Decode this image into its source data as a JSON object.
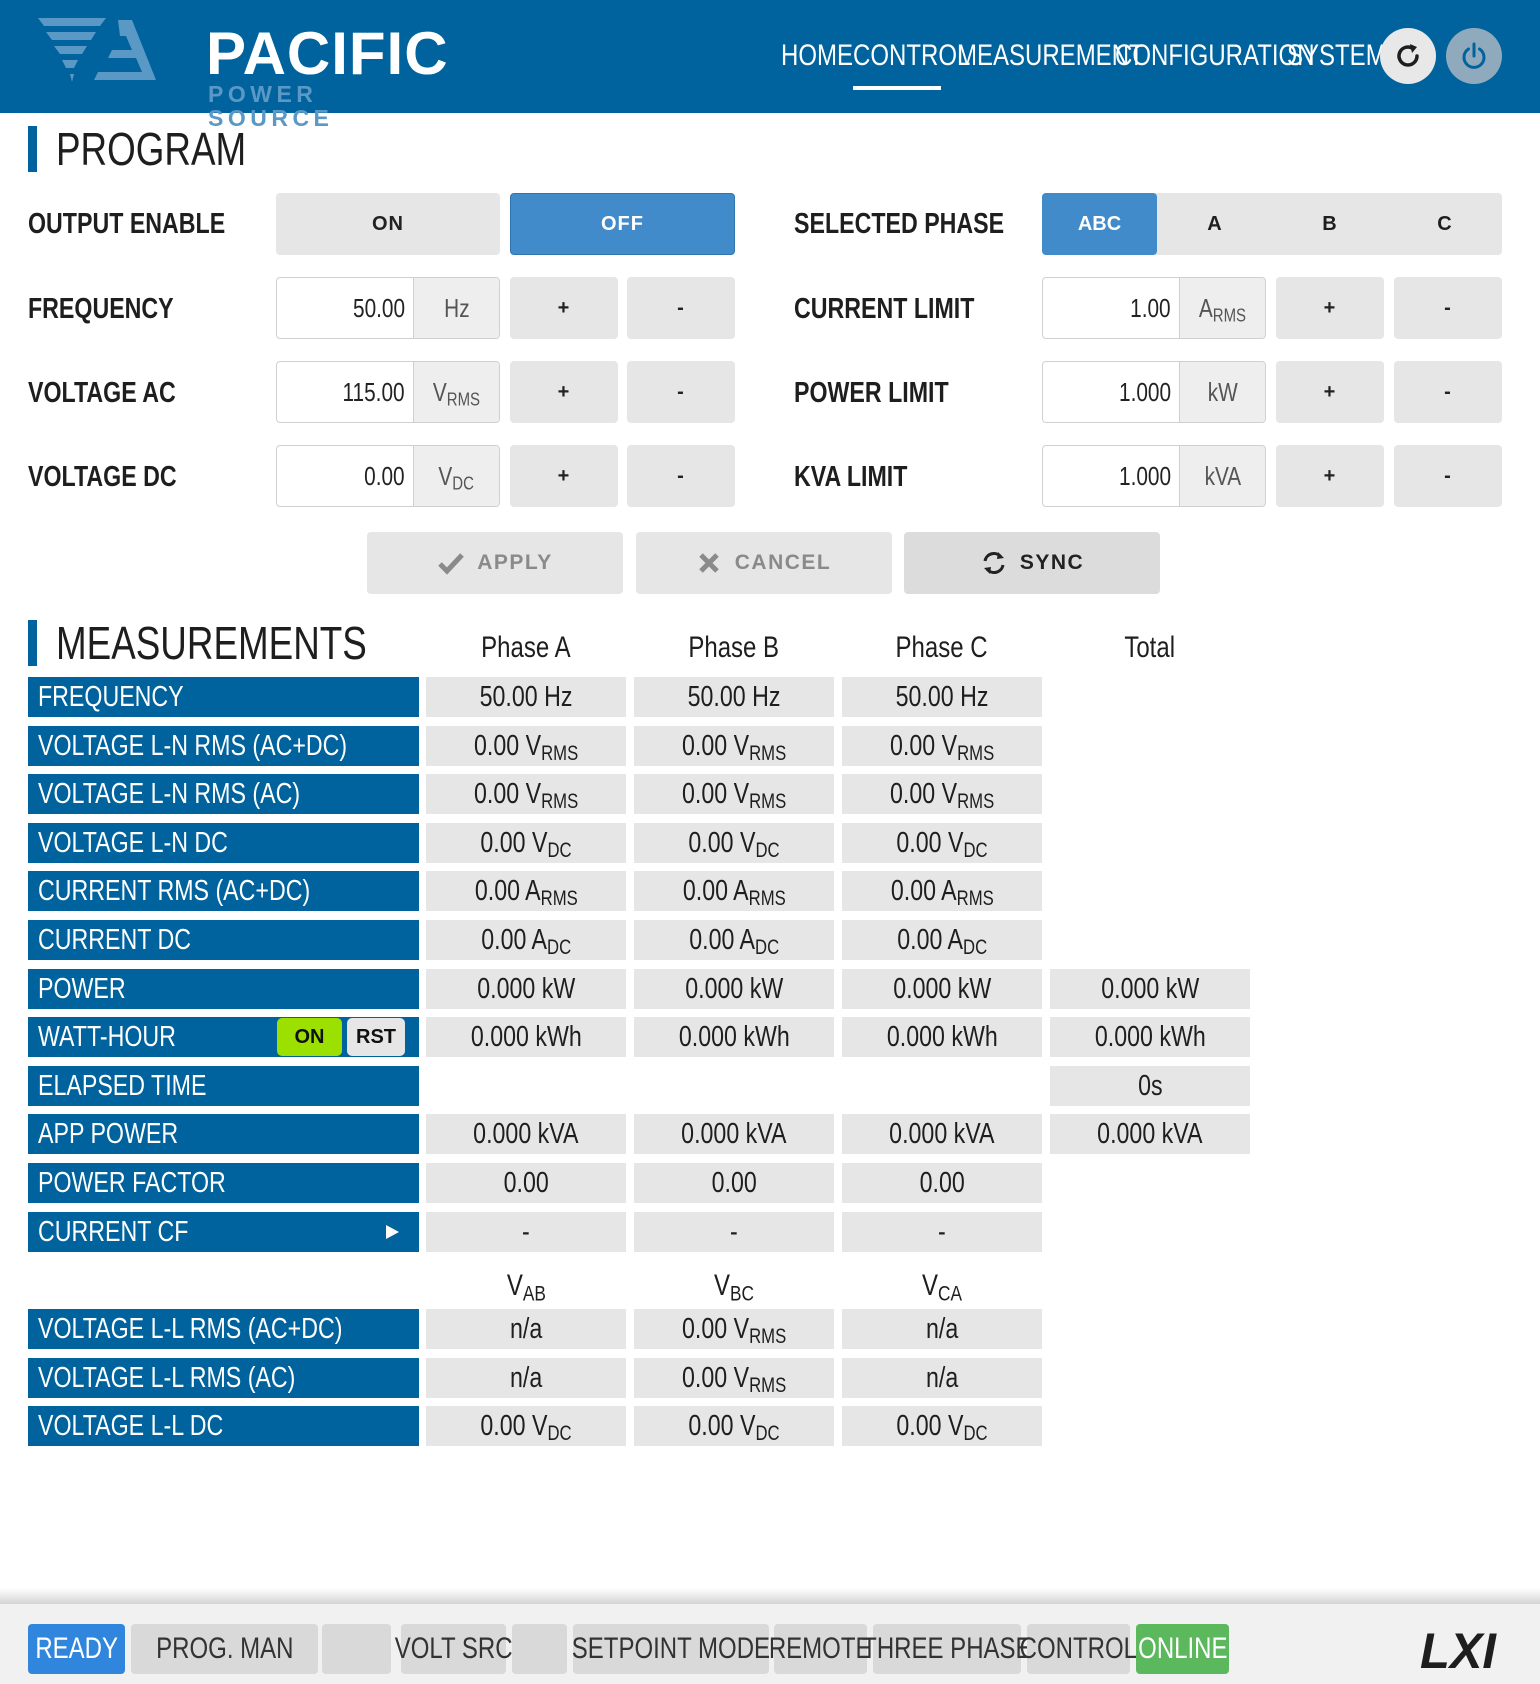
{
  "brand": {
    "name": "PACIFIC",
    "subtitle": "POWER SOURCE"
  },
  "nav": [
    {
      "label": "HOME",
      "active": false
    },
    {
      "label": "CONTROL",
      "active": true
    },
    {
      "label": "MEASUREMENT",
      "active": false
    },
    {
      "label": "CONFIGURATION",
      "active": false
    },
    {
      "label": "SYSTEM",
      "active": false
    }
  ],
  "header_icons": [
    "refresh-icon",
    "power-icon"
  ],
  "program": {
    "title": "PROGRAM",
    "output_enable": {
      "label": "OUTPUT ENABLE",
      "on": "ON",
      "off": "OFF",
      "selected": "OFF"
    },
    "selected_phase": {
      "label": "SELECTED PHASE",
      "options": [
        "ABC",
        "A",
        "B",
        "C"
      ],
      "selected": "ABC"
    },
    "frequency": {
      "label": "FREQUENCY",
      "value": "50.00",
      "unit": "Hz"
    },
    "voltage_ac": {
      "label": "VOLTAGE AC",
      "value": "115.00",
      "unit": "V",
      "unit_sub": "RMS"
    },
    "voltage_dc": {
      "label": "VOLTAGE DC",
      "value": "0.00",
      "unit": "V",
      "unit_sub": "DC"
    },
    "current_limit": {
      "label": "CURRENT LIMIT",
      "value": "1.00",
      "unit": "A",
      "unit_sub": "RMS"
    },
    "power_limit": {
      "label": "POWER LIMIT",
      "value": "1.000",
      "unit": "kW"
    },
    "kva_limit": {
      "label": "KVA LIMIT",
      "value": "1.000",
      "unit": "kVA"
    },
    "plus": "+",
    "minus": "-",
    "actions": {
      "apply": "APPLY",
      "cancel": "CANCEL",
      "sync": "SYNC"
    }
  },
  "measurements": {
    "title": "MEASUREMENTS",
    "columns": [
      "Phase A",
      "Phase B",
      "Phase C",
      "Total"
    ],
    "rows": [
      {
        "label": "FREQUENCY",
        "cells": [
          [
            "50.00 Hz",
            ""
          ],
          [
            "50.00 Hz",
            ""
          ],
          [
            "50.00 Hz",
            ""
          ],
          null
        ]
      },
      {
        "label": "VOLTAGE L-N RMS (AC+DC)",
        "cells": [
          [
            "0.00 V",
            "RMS"
          ],
          [
            "0.00 V",
            "RMS"
          ],
          [
            "0.00 V",
            "RMS"
          ],
          null
        ]
      },
      {
        "label": "VOLTAGE L-N RMS (AC)",
        "cells": [
          [
            "0.00 V",
            "RMS"
          ],
          [
            "0.00 V",
            "RMS"
          ],
          [
            "0.00 V",
            "RMS"
          ],
          null
        ]
      },
      {
        "label": "VOLTAGE L-N DC",
        "cells": [
          [
            "0.00 V",
            "DC"
          ],
          [
            "0.00 V",
            "DC"
          ],
          [
            "0.00 V",
            "DC"
          ],
          null
        ]
      },
      {
        "label": "CURRENT RMS (AC+DC)",
        "cells": [
          [
            "0.00 A",
            "RMS"
          ],
          [
            "0.00 A",
            "RMS"
          ],
          [
            "0.00 A",
            "RMS"
          ],
          null
        ]
      },
      {
        "label": "CURRENT DC",
        "cells": [
          [
            "0.00 A",
            "DC"
          ],
          [
            "0.00 A",
            "DC"
          ],
          [
            "0.00 A",
            "DC"
          ],
          null
        ]
      },
      {
        "label": "POWER",
        "cells": [
          [
            "0.000 kW",
            ""
          ],
          [
            "0.000 kW",
            ""
          ],
          [
            "0.000 kW",
            ""
          ],
          [
            "0.000 kW",
            ""
          ]
        ]
      },
      {
        "label": "WATT-HOUR",
        "cells": [
          [
            "0.000 kWh",
            ""
          ],
          [
            "0.000 kWh",
            ""
          ],
          [
            "0.000 kWh",
            ""
          ],
          [
            "0.000 kWh",
            ""
          ]
        ]
      },
      {
        "label": "ELAPSED TIME",
        "cells": [
          null,
          null,
          null,
          [
            "0s",
            ""
          ]
        ]
      },
      {
        "label": "APP POWER",
        "cells": [
          [
            "0.000 kVA",
            ""
          ],
          [
            "0.000 kVA",
            ""
          ],
          [
            "0.000 kVA",
            ""
          ],
          [
            "0.000 kVA",
            ""
          ]
        ]
      },
      {
        "label": "POWER FACTOR",
        "cells": [
          [
            "0.00",
            ""
          ],
          [
            "0.00",
            ""
          ],
          [
            "0.00",
            ""
          ],
          null
        ]
      },
      {
        "label": "CURRENT CF",
        "cells": [
          [
            "-",
            ""
          ],
          [
            "-",
            ""
          ],
          [
            "-",
            ""
          ],
          null
        ]
      }
    ],
    "watt_hour_on": "ON",
    "watt_hour_rst": "RST",
    "ll_columns": [
      [
        "V",
        "AB"
      ],
      [
        "V",
        "BC"
      ],
      [
        "V",
        "CA"
      ]
    ],
    "ll_rows": [
      {
        "label": "VOLTAGE L-L RMS (AC+DC)",
        "cells": [
          [
            "n/a",
            ""
          ],
          [
            "0.00 V",
            "RMS"
          ],
          [
            "n/a",
            ""
          ]
        ]
      },
      {
        "label": "VOLTAGE L-L RMS (AC)",
        "cells": [
          [
            "n/a",
            ""
          ],
          [
            "0.00 V",
            "RMS"
          ],
          [
            "n/a",
            ""
          ]
        ]
      },
      {
        "label": "VOLTAGE L-L DC",
        "cells": [
          [
            "0.00 V",
            "DC"
          ],
          [
            "0.00 V",
            "DC"
          ],
          [
            "0.00 V",
            "DC"
          ]
        ]
      }
    ]
  },
  "status_bar": [
    {
      "label": "READY",
      "style": "ready"
    },
    {
      "label": "PROG. MAN",
      "style": "normal"
    },
    {
      "label": "",
      "style": "normal"
    },
    {
      "label": "VOLT SRC",
      "style": "normal"
    },
    {
      "label": "",
      "style": "normal"
    },
    {
      "label": "SETPOINT MODE",
      "style": "normal"
    },
    {
      "label": "REMOTE",
      "style": "normal"
    },
    {
      "label": "THREE PHASE",
      "style": "normal"
    },
    {
      "label": "CONTROL",
      "style": "normal"
    },
    {
      "label": "ONLINE",
      "style": "online"
    }
  ],
  "lxi_logo": "LXI",
  "colors": {
    "header": "#00639d",
    "selected": "#428bca",
    "ready": "#2f86dc",
    "online": "#5cb85c",
    "wh_on": "#9ce000"
  }
}
